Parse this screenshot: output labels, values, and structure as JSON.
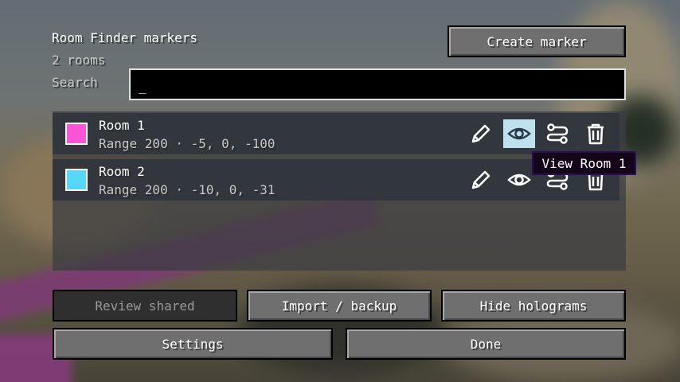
{
  "header": {
    "title": "Room Finder markers",
    "room_count": "2 rooms",
    "search_label": "Search"
  },
  "search": {
    "value": "_"
  },
  "create_marker_label": "Create marker",
  "rooms": [
    {
      "name": "Room 1",
      "info": "Range 200 · -5, 0, -100",
      "color": "#ff55d6"
    },
    {
      "name": "Room 2",
      "info": "Range 200 · -10, 0, -31",
      "color": "#55d7ff"
    }
  ],
  "tooltip": "View Room 1",
  "footer": {
    "review_shared": "Review shared",
    "import_backup": "Import / backup",
    "hide_holograms": "Hide holograms",
    "settings": "Settings",
    "done": "Done"
  }
}
